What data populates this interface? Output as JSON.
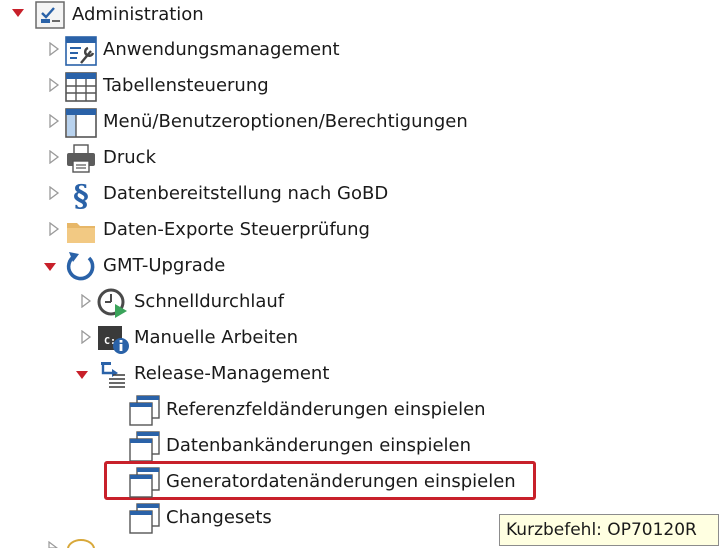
{
  "tree": {
    "root": {
      "label": "Administration",
      "icon": "admin-checklist-icon",
      "expanded": true
    },
    "items": [
      {
        "label": "Anwendungsmanagement",
        "icon": "window-wrench-icon"
      },
      {
        "label": "Tabellensteuerung",
        "icon": "table-grid-icon"
      },
      {
        "label": "Menü/Benutzeroptionen/Berechtigungen",
        "icon": "window-panel-icon"
      },
      {
        "label": "Druck",
        "icon": "printer-icon"
      },
      {
        "label": "Datenbereitstellung nach GoBD",
        "icon": "paragraph-icon"
      },
      {
        "label": "Daten-Exporte Steuerprüfung",
        "icon": "folder-icon"
      },
      {
        "label": "GMT-Upgrade",
        "icon": "refresh-arrow-icon",
        "expanded": true
      }
    ],
    "gmt_children": [
      {
        "label": "Schnelldurchlauf",
        "icon": "clock-play-icon"
      },
      {
        "label": "Manuelle Arbeiten",
        "icon": "window-info-icon"
      },
      {
        "label": "Release-Management",
        "icon": "arrow-list-icon",
        "expanded": true
      }
    ],
    "release_children": [
      {
        "label": "Referenzfeldänderungen einspielen",
        "icon": "stacked-windows-icon"
      },
      {
        "label": "Datenbankänderungen einspielen",
        "icon": "stacked-windows-icon"
      },
      {
        "label": "Generatordatenänderungen einspielen",
        "icon": "stacked-windows-icon",
        "highlighted": true
      },
      {
        "label": "Changesets",
        "icon": "stacked-windows-icon"
      }
    ]
  },
  "tooltip": {
    "text": "Kurzbefehl: OP70120R"
  },
  "colors": {
    "expand_arrow": "#c8202a",
    "collapse_arrow": "#9a9a9a",
    "highlight_border": "#c8202a",
    "tooltip_bg": "#ffffe1"
  }
}
